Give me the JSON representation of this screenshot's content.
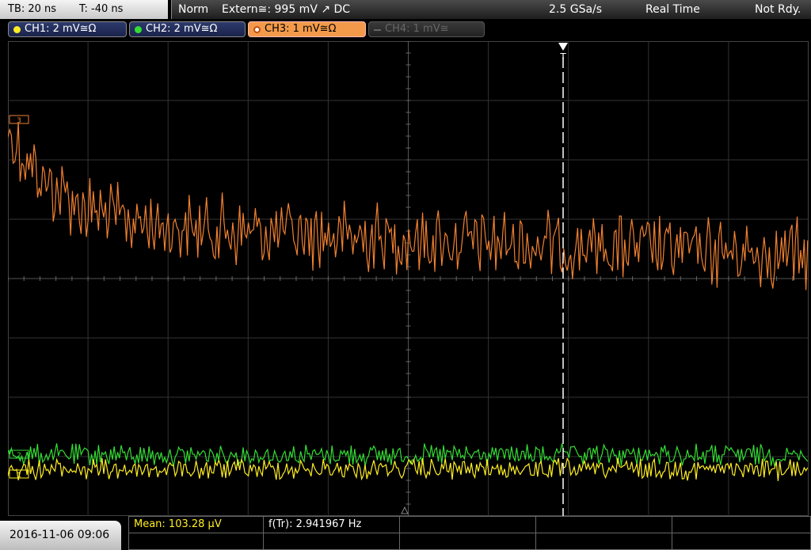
{
  "status": {
    "timebase": "TB: 20 ns",
    "trigger_time": "T: -40 ns",
    "trigger_mode": "Norm",
    "trigger_source": "Extern≅: 995 mV ↗ DC",
    "sample_rate": "2.5 GSa/s",
    "acq_mode": "Real Time",
    "run_state": "Not Rdy."
  },
  "channels": [
    {
      "label": "CH1: 2 mV≅Ω",
      "color": "#ffee22"
    },
    {
      "label": "CH2: 2 mV≅Ω",
      "color": "#33dd33"
    },
    {
      "label": "CH3: 1 mV≅Ω",
      "color": "#f08030"
    },
    {
      "label": "CH4: 1 mV≅",
      "color": "#666666"
    }
  ],
  "markers": {
    "trigger": "T",
    "ch1": "1",
    "ch2": "2",
    "ch3": "3"
  },
  "datetime": "2016-11-06 09:06",
  "measurements": {
    "mean": "Mean: 103.28 µV",
    "freq": "f(Tr): 2.941967 Hz"
  }
}
